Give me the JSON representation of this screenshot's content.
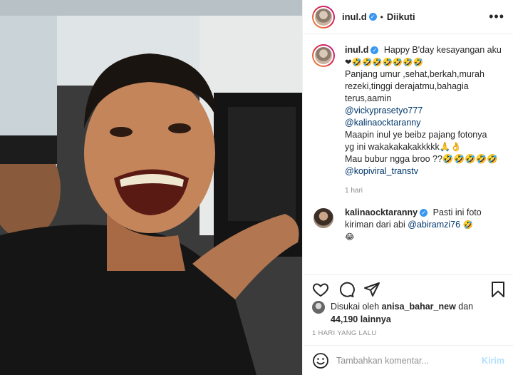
{
  "post_author": {
    "username": "inul.d",
    "separator": "•",
    "follow_status": "Diikuti",
    "more": "•••"
  },
  "caption": {
    "username": "inul.d",
    "text_lines": [
      "Happy B'day kesayangan aku",
      "❤🤣🤣🤣🤣🤣🤣🤣",
      "Panjang umur ,sehat,berkah,murah",
      "rezeki,tinggi derajatmu,bahagia",
      "terus,aamin"
    ],
    "mention_1": "@vickyprasetyo777",
    "mention_2": "@kalinaocktaranny",
    "text_lines_2": [
      "Maapin inul ye beibz pajang fotonya",
      "yg ini wakakakakakkkkk🙏👌",
      "Mau bubur ngga broo ??🤣🤣🤣🤣🤣"
    ],
    "mention_3": "@kopiviral_transtv",
    "timestamp": "1 hari"
  },
  "comment": {
    "username": "kalinaocktaranny",
    "text_before": "Pasti ini foto",
    "text_line2": "kiriman dari abi ",
    "mention": "@abiramzi76",
    "emoji_1": " 🤣",
    "emoji_2": "😂"
  },
  "likes": {
    "prefix": "Disukai oleh ",
    "user": "anisa_bahar_new",
    "middle": " dan",
    "count": "44,190 lainnya"
  },
  "time_ago": "1 HARI YANG LALU",
  "comment_input": {
    "placeholder": "Tambahkan komentar...",
    "post_label": "Kirim"
  },
  "icons": [
    "heart-icon",
    "comment-icon",
    "share-icon",
    "bookmark-icon",
    "emoji-icon",
    "verified-icon"
  ],
  "colors": {
    "verified": "#3897f0",
    "mention": "#00376b",
    "post_button_disabled": "#b2dffc"
  }
}
